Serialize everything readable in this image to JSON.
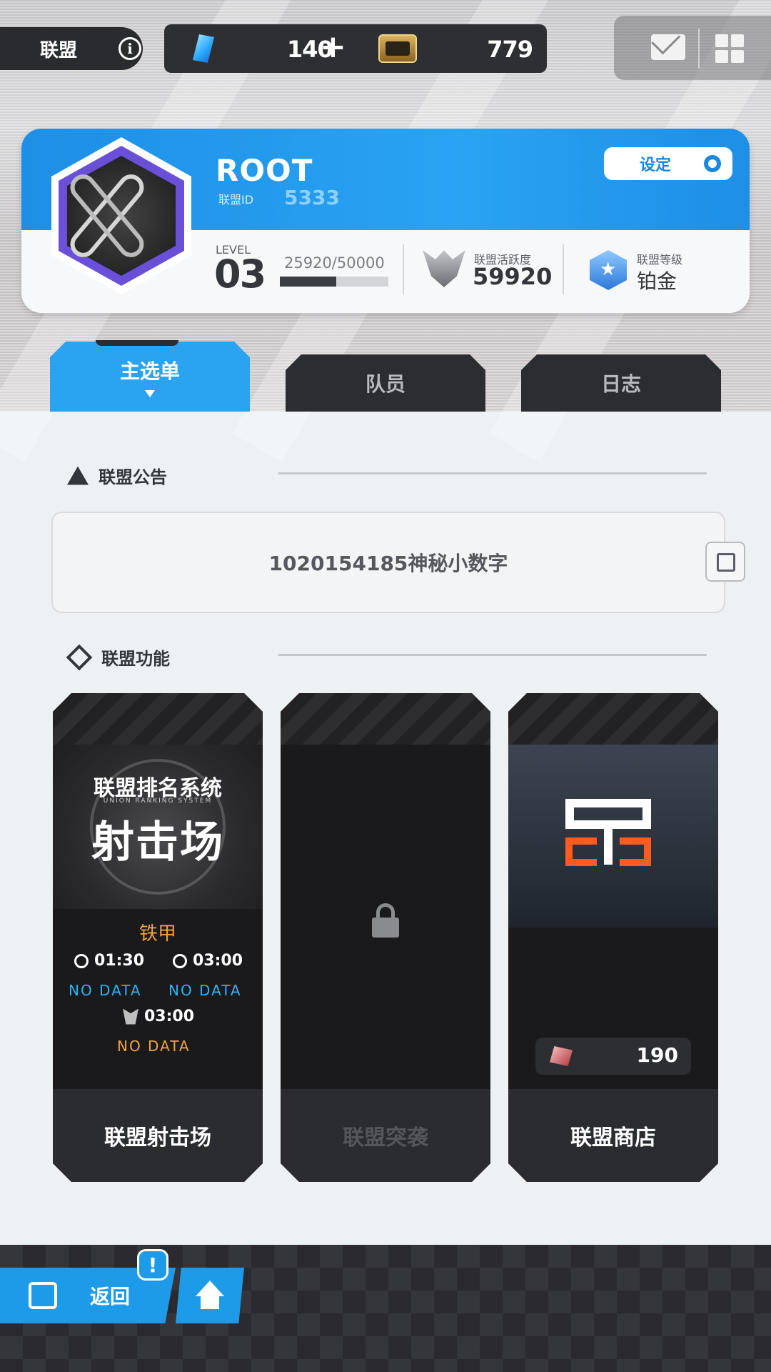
{
  "header": {
    "title": "联盟",
    "gems": "140",
    "gems_plus": "+",
    "tickets": "779"
  },
  "union": {
    "name": "ROOT",
    "id_label": "联盟ID",
    "id": "5333",
    "settings_label": "设定",
    "level_label": "LEVEL",
    "level": "03",
    "exp_text": "25920/50000",
    "exp_fraction": 0.5184,
    "activity_label": "联盟活跃度",
    "activity": "59920",
    "rank_label": "联盟等级",
    "rank": "铂金"
  },
  "tabs": [
    {
      "label": "主选单",
      "active": true
    },
    {
      "label": "队员",
      "active": false
    },
    {
      "label": "日志",
      "active": false
    }
  ],
  "notice": {
    "title": "联盟公告",
    "text": "1020154185神秘小数字"
  },
  "functions": {
    "title": "联盟功能",
    "range": {
      "subtitle": "联盟排名系统",
      "tag": "UNION RANKING SYSTEM",
      "title": "射击场",
      "rank": "铁甲",
      "time1": "01:30",
      "time2": "03:00",
      "time3": "03:00",
      "nodata": "NO DATA",
      "label": "联盟射击场"
    },
    "raid": {
      "label": "联盟突袭"
    },
    "shop": {
      "currency": "190",
      "label": "联盟商店"
    }
  },
  "nav": {
    "back_label": "返回",
    "alert": "!"
  }
}
